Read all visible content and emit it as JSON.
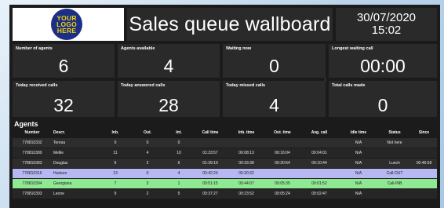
{
  "header": {
    "logo_lines": [
      "YOUR",
      "LOGO",
      "HERE"
    ],
    "title": "Sales queue wallboard",
    "date": "30/07/2020",
    "time": "15:02"
  },
  "kpis": [
    {
      "label": "Number of agents",
      "value": "6"
    },
    {
      "label": "Agents available",
      "value": "4"
    },
    {
      "label": "Waiting now",
      "value": "0"
    },
    {
      "label": "Longest waiting call",
      "value": "00:00"
    },
    {
      "label": "Today received calls",
      "value": "32"
    },
    {
      "label": "Today answered calls",
      "value": "28"
    },
    {
      "label": "Today missed calls",
      "value": "4"
    },
    {
      "label": "Total calls made",
      "value": "0"
    }
  ],
  "agents": {
    "title": "Agents",
    "columns": [
      "Number",
      "Descr.",
      "Inb.",
      "Out.",
      "Int.",
      "Call time",
      "Inb. time",
      "Out. time",
      "Avg. call",
      "Idle time",
      "Status",
      "Since"
    ],
    "rows": [
      [
        "778810332",
        "Teresa",
        "0",
        "0",
        "0",
        "",
        "",
        "",
        "",
        "N/A",
        "Not here",
        ""
      ],
      [
        "778810380",
        "Mellie",
        "11",
        "4",
        "10",
        "01:23:57",
        "00:08:13",
        "00:16:04",
        "00:04:01",
        "N/A",
        "",
        ""
      ],
      [
        "778810383",
        "Douglas",
        "6",
        "2",
        "6",
        "01:39:19",
        "00:33:38",
        "00:20:64",
        "00:10:44",
        "N/A",
        "Lunch",
        "00:46:58"
      ],
      [
        "778810316",
        "Hudson",
        "13",
        "0",
        "4",
        "00:42:24",
        "00:30:32",
        "",
        "",
        "N/A",
        "Call-OUT",
        ""
      ],
      [
        "778810394",
        "Georgiana",
        "7",
        "3",
        "1",
        "00:51:15",
        "00:44:07",
        "00:05:35",
        "00:01:52",
        "N/A",
        "Call-INB",
        ""
      ],
      [
        "778810393",
        "Leone",
        "9",
        "2",
        "5",
        "00:37:27",
        "00:23:52",
        "00:05:24",
        "00:02:47",
        "N/A",
        "",
        ""
      ]
    ],
    "row_highlights": [
      "",
      "",
      "",
      "#b7b7f2",
      "#8fe892",
      ""
    ]
  }
}
